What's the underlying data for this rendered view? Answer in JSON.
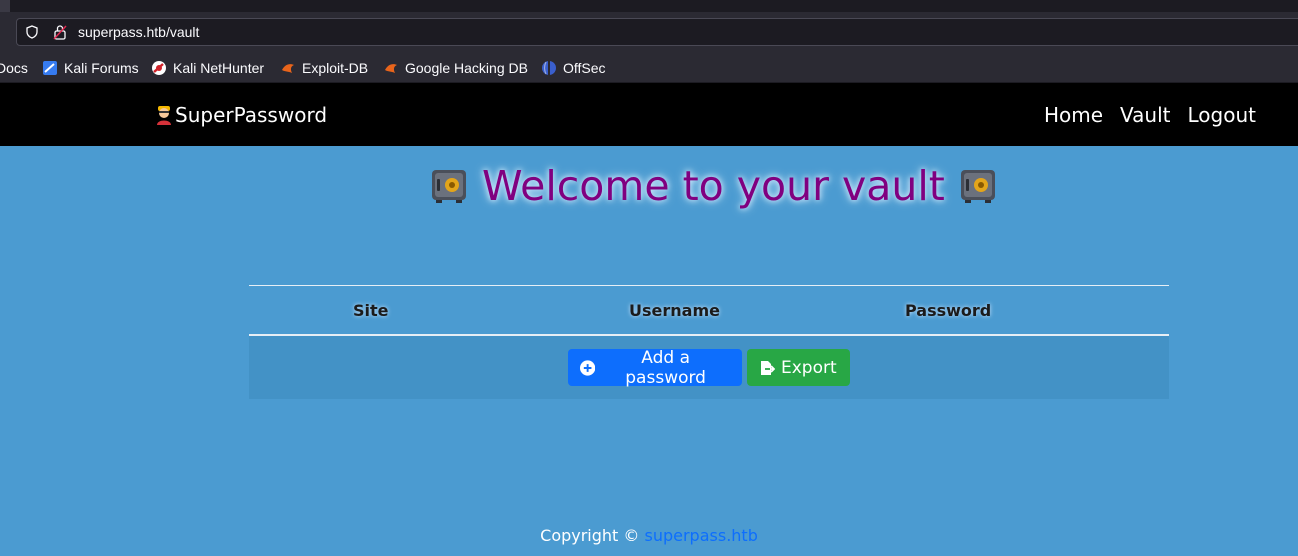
{
  "browser": {
    "url": "superpass.htb/vault",
    "bookmarks": [
      {
        "label": "Docs",
        "icon": "docs-icon"
      },
      {
        "label": "Kali Forums",
        "icon": "kali-forums-icon"
      },
      {
        "label": "Kali NetHunter",
        "icon": "kali-nethunter-icon"
      },
      {
        "label": "Exploit-DB",
        "icon": "exploit-db-icon"
      },
      {
        "label": "Google Hacking DB",
        "icon": "ghdb-icon"
      },
      {
        "label": "OffSec",
        "icon": "offsec-icon"
      }
    ]
  },
  "navbar": {
    "brand": "SuperPassword",
    "links": [
      "Home",
      "Vault",
      "Logout"
    ]
  },
  "main": {
    "heading": "Welcome to your vault",
    "table": {
      "columns": [
        "Site",
        "Username",
        "Password"
      ],
      "rows": []
    },
    "buttons": {
      "add": "Add a password",
      "export": "Export"
    }
  },
  "footer": {
    "text": "Copyright ©",
    "link": "superpass.htb"
  },
  "colors": {
    "page_bg": "#4b9bd1",
    "heading": "#800080",
    "primary": "#0d6efd",
    "success": "#28a745"
  }
}
